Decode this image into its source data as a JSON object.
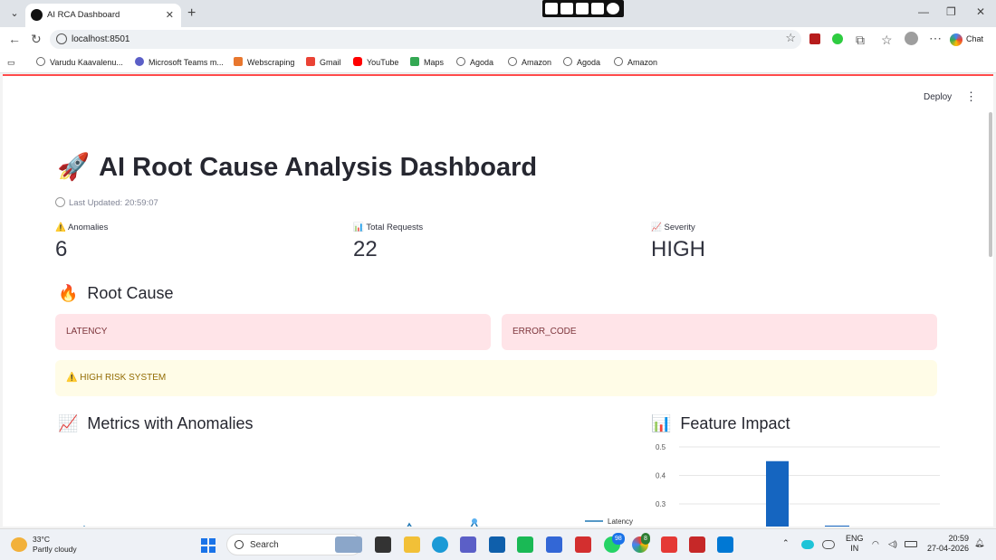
{
  "browser": {
    "tab_title": "AI RCA Dashboard",
    "url": "localhost:8501",
    "chat_label": "Chat",
    "bookmarks": [
      {
        "label": "Varudu Kaavalenu...",
        "color": "#666666"
      },
      {
        "label": "Microsoft Teams m...",
        "color": "#5b5fc7"
      },
      {
        "label": "Webscraping",
        "color": "#e8772e"
      },
      {
        "label": "Gmail",
        "color": "#ea4335"
      },
      {
        "label": "YouTube",
        "color": "#ff0000"
      },
      {
        "label": "Maps",
        "color": "#34a853"
      },
      {
        "label": "Agoda",
        "color": "#666666"
      },
      {
        "label": "Amazon",
        "color": "#666666"
      },
      {
        "label": "Agoda",
        "color": "#666666"
      },
      {
        "label": "Amazon",
        "color": "#666666"
      }
    ]
  },
  "app": {
    "deploy_label": "Deploy",
    "title_emoji": "🚀",
    "title": "AI Root Cause Analysis Dashboard",
    "last_updated": "Last Updated: 20:59:07",
    "metrics": [
      {
        "icon": "⚠️",
        "label": "Anomalies",
        "value": "6"
      },
      {
        "icon": "📊",
        "label": "Total Requests",
        "value": "22"
      },
      {
        "icon": "📈",
        "label": "Severity",
        "value": "HIGH"
      }
    ],
    "root_cause": {
      "emoji": "🔥",
      "heading": "Root Cause",
      "items": [
        "LATENCY",
        "ERROR_CODE"
      ]
    },
    "warning": "⚠️ HIGH RISK SYSTEM",
    "metrics_section": {
      "emoji": "📈",
      "heading": "Metrics with Anomalies",
      "legend": "Latency"
    },
    "impact_section": {
      "emoji": "📊",
      "heading": "Feature Impact"
    }
  },
  "chart_data": [
    {
      "type": "line",
      "title": "",
      "series": [
        {
          "name": "Latency",
          "color": "#1f77b4"
        }
      ]
    },
    {
      "type": "bar",
      "title": "",
      "y_ticks": [
        0.3,
        0.4,
        0.5
      ],
      "ylim": [
        0.3,
        0.5
      ],
      "values": [
        0.45
      ],
      "color": "#1565c0"
    }
  ],
  "taskbar": {
    "temperature": "33°C",
    "weather": "Partly cloudy",
    "search_placeholder": "Search",
    "lang_top": "ENG",
    "lang_bottom": "IN",
    "time": "20:59",
    "date": "27-04-2026",
    "whatsapp_badge": "98",
    "chrome_badge": "8"
  }
}
